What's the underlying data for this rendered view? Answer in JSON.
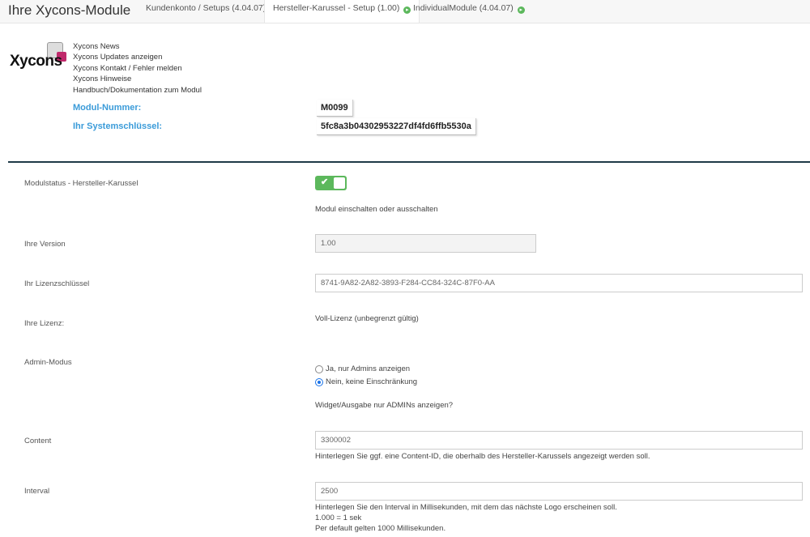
{
  "header": {
    "title": "Ihre Xycons-Module",
    "tabs": [
      {
        "label": "Kundenkonto / Setups (4.04.07)",
        "icon": "arrow-right-circle-icon"
      },
      {
        "label": "Hersteller-Karussel - Setup (1.00)",
        "icon": "arrow-right-circle-icon",
        "active": true
      },
      {
        "label": "IndividualModule (4.04.07)",
        "icon": "arrow-right-circle-icon"
      }
    ]
  },
  "logo": {
    "text": "Xycons"
  },
  "links": [
    "Xycons News",
    "Xycons Updates anzeigen",
    "Xycons Kontakt / Fehler melden",
    "Xycons Hinweise",
    "Handbuch/Dokumentation zum Modul"
  ],
  "module_info": {
    "number_label": "Modul-Nummer:",
    "number_value": "M0099",
    "key_label": "Ihr Systemschlüssel:",
    "key_value": "5fc8a3b04302953227df4fd6ffb5530a"
  },
  "form": {
    "status": {
      "label": "Modulstatus - Hersteller-Karussel",
      "enabled": true,
      "hint": "Modul einschalten oder ausschalten"
    },
    "version": {
      "label": "Ihre Version",
      "value": "1.00"
    },
    "license_key": {
      "label": "Ihr Lizenzschlüssel",
      "value": "8741-9A82-2A82-3893-F284-CC84-324C-87F0-AA"
    },
    "license": {
      "label": "Ihre Lizenz:",
      "value": "Voll-Lizenz (unbegrenzt gültig)"
    },
    "admin_mode": {
      "label": "Admin-Modus",
      "options": [
        "Ja, nur Admins anzeigen",
        "Nein, keine Einschränkung"
      ],
      "selected": "Nein, keine Einschränkung",
      "hint": "Widget/Ausgabe nur ADMINs anzeigen?"
    },
    "content": {
      "label": "Content",
      "value": "3300002",
      "hint": "Hinterlegen Sie ggf. eine Content-ID, die oberhalb des Hersteller-Karussels angezeigt werden soll."
    },
    "interval": {
      "label": "Interval",
      "value": "2500",
      "hint_lines": [
        "Hinterlegen Sie den Interval in Millisekunden, mit dem das nächste Logo erscheinen soll.",
        "1.000 = 1 sek",
        "Per default gelten 1000 Millisekunden."
      ]
    }
  },
  "colors": {
    "accent_blue": "#3a9bd9",
    "toggle_green": "#5cb85c",
    "divider": "#1f3a47"
  }
}
